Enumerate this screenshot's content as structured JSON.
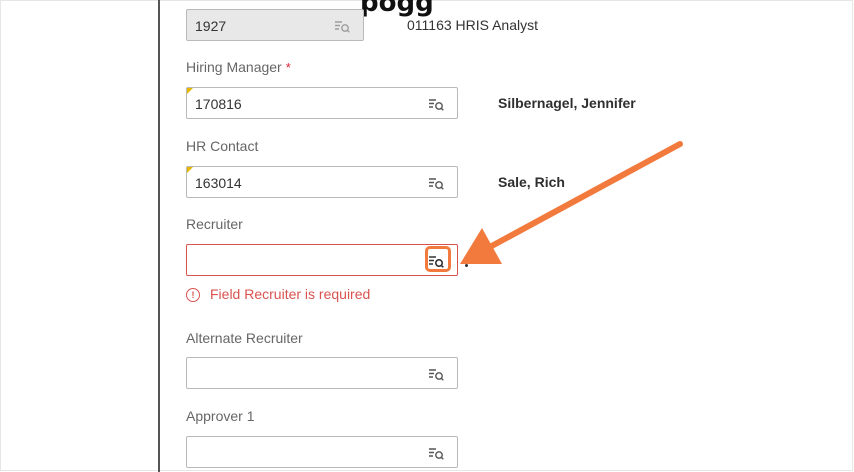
{
  "partial_heading": "pogg",
  "position": {
    "code": "1927",
    "title": "011163 HRIS Analyst"
  },
  "hiring_manager": {
    "label": "Hiring Manager",
    "required_mark": "*",
    "value": "170816",
    "name": "Silbernagel, Jennifer"
  },
  "hr_contact": {
    "label": "HR Contact",
    "value": "163014",
    "name": "Sale, Rich"
  },
  "recruiter": {
    "label": "Recruiter",
    "value": "",
    "error": "Field Recruiter is required",
    "error_icon": "!"
  },
  "alternate_recruiter": {
    "label": "Alternate Recruiter",
    "value": ""
  },
  "approver_1": {
    "label": "Approver 1",
    "value": ""
  },
  "colors": {
    "error": "#d9534f",
    "arrow": "#f27a3d",
    "required": "#dd2233",
    "mandatory_marker": "#e6b800"
  },
  "icons": {
    "lookup": "lookup-icon",
    "error": "error-circle-icon",
    "arrow": "annotation-arrow"
  }
}
